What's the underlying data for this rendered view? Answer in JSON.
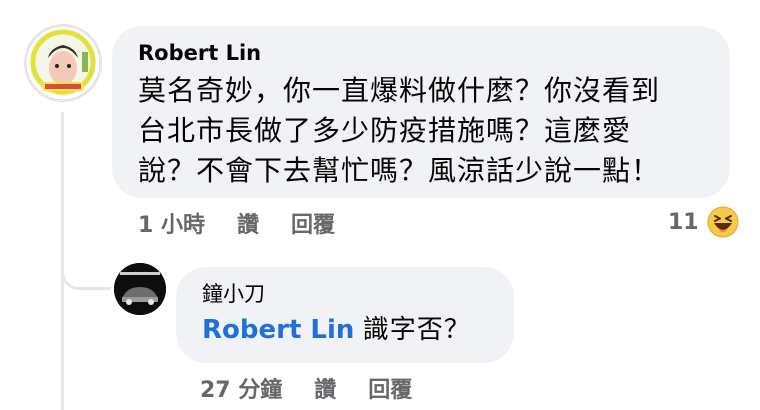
{
  "comment": {
    "author": "Robert Lin",
    "lines": [
      "莫名奇妙，你一直爆料做什麼？你沒看到",
      "台北市長做了多少防疫措施嗎？這麼愛",
      "說？不會下去幫忙嗎？風涼話少說一點！"
    ],
    "time": "1 小時",
    "like_label": "讚",
    "reply_label": "回覆",
    "reaction_count": "11",
    "reaction_icon": "haha-emoji-icon"
  },
  "reply": {
    "author": "鐘小刀",
    "mention": "Robert Lin",
    "text": "識字否？",
    "time": "27 分鐘",
    "like_label": "讚",
    "reply_label": "回覆"
  },
  "colors": {
    "bubble": "#f0f2f5",
    "meta_text": "#65676b",
    "mention": "#216fdb",
    "thread_line": "#e4e6eb"
  }
}
